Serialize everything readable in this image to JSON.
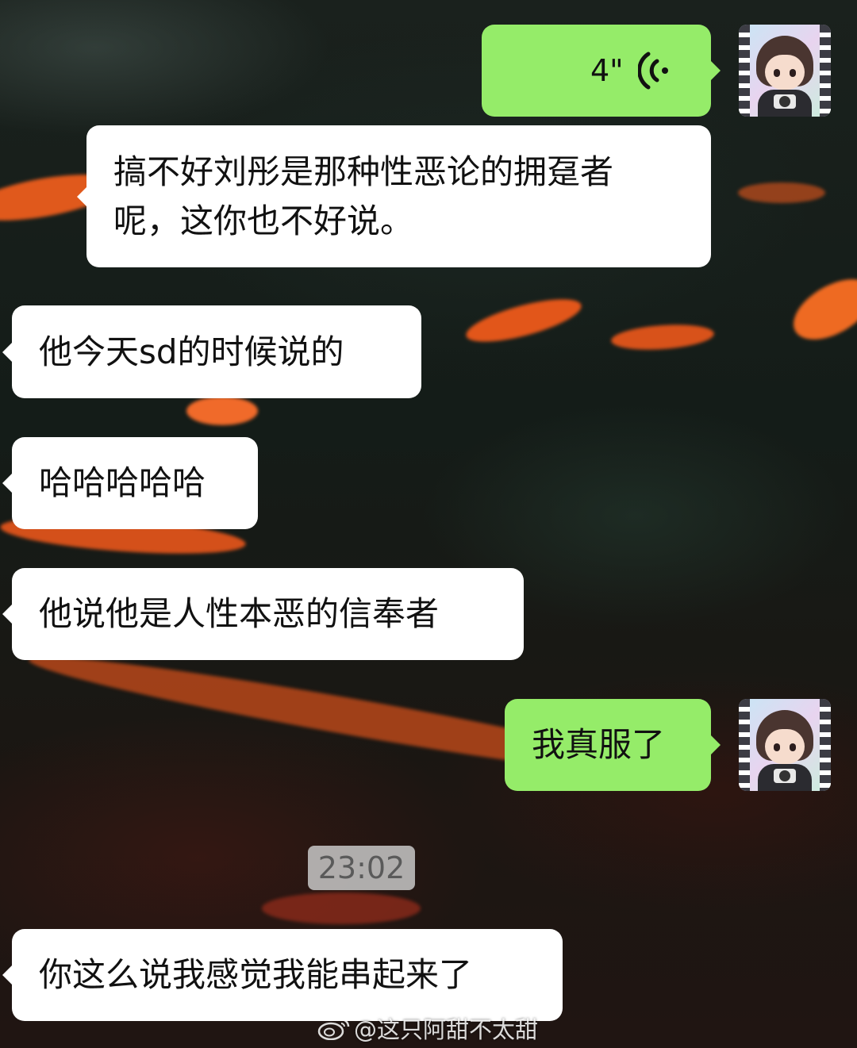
{
  "messages": [
    {
      "id": "m1",
      "direction": "outgoing",
      "type": "voice",
      "duration": "4\""
    },
    {
      "id": "m2",
      "direction": "incoming",
      "type": "text",
      "lines": [
        "搞不好刘彤是那种性恶论的拥趸者",
        "呢，这你也不好说。"
      ]
    },
    {
      "id": "m3",
      "direction": "incoming",
      "type": "text",
      "text": "他今天sd的时候说的"
    },
    {
      "id": "m4",
      "direction": "incoming",
      "type": "text",
      "text": "哈哈哈哈哈"
    },
    {
      "id": "m5",
      "direction": "incoming",
      "type": "text",
      "text": "他说他是人性本恶的信奉者"
    },
    {
      "id": "m6",
      "direction": "outgoing",
      "type": "text",
      "text": "我真服了"
    },
    {
      "id": "m7",
      "direction": "incoming",
      "type": "text",
      "text": "你这么说我感觉我能串起来了"
    }
  ],
  "timestamp": "23:02",
  "watermark": "@这只阿甜不太甜",
  "colors": {
    "outgoing_bubble": "#95ec69",
    "incoming_bubble": "#ffffff",
    "timestamp_bg": "#c8c8c8"
  },
  "icons": {
    "voice": "voice-wave-icon",
    "watermark_logo": "weibo-logo-icon"
  }
}
